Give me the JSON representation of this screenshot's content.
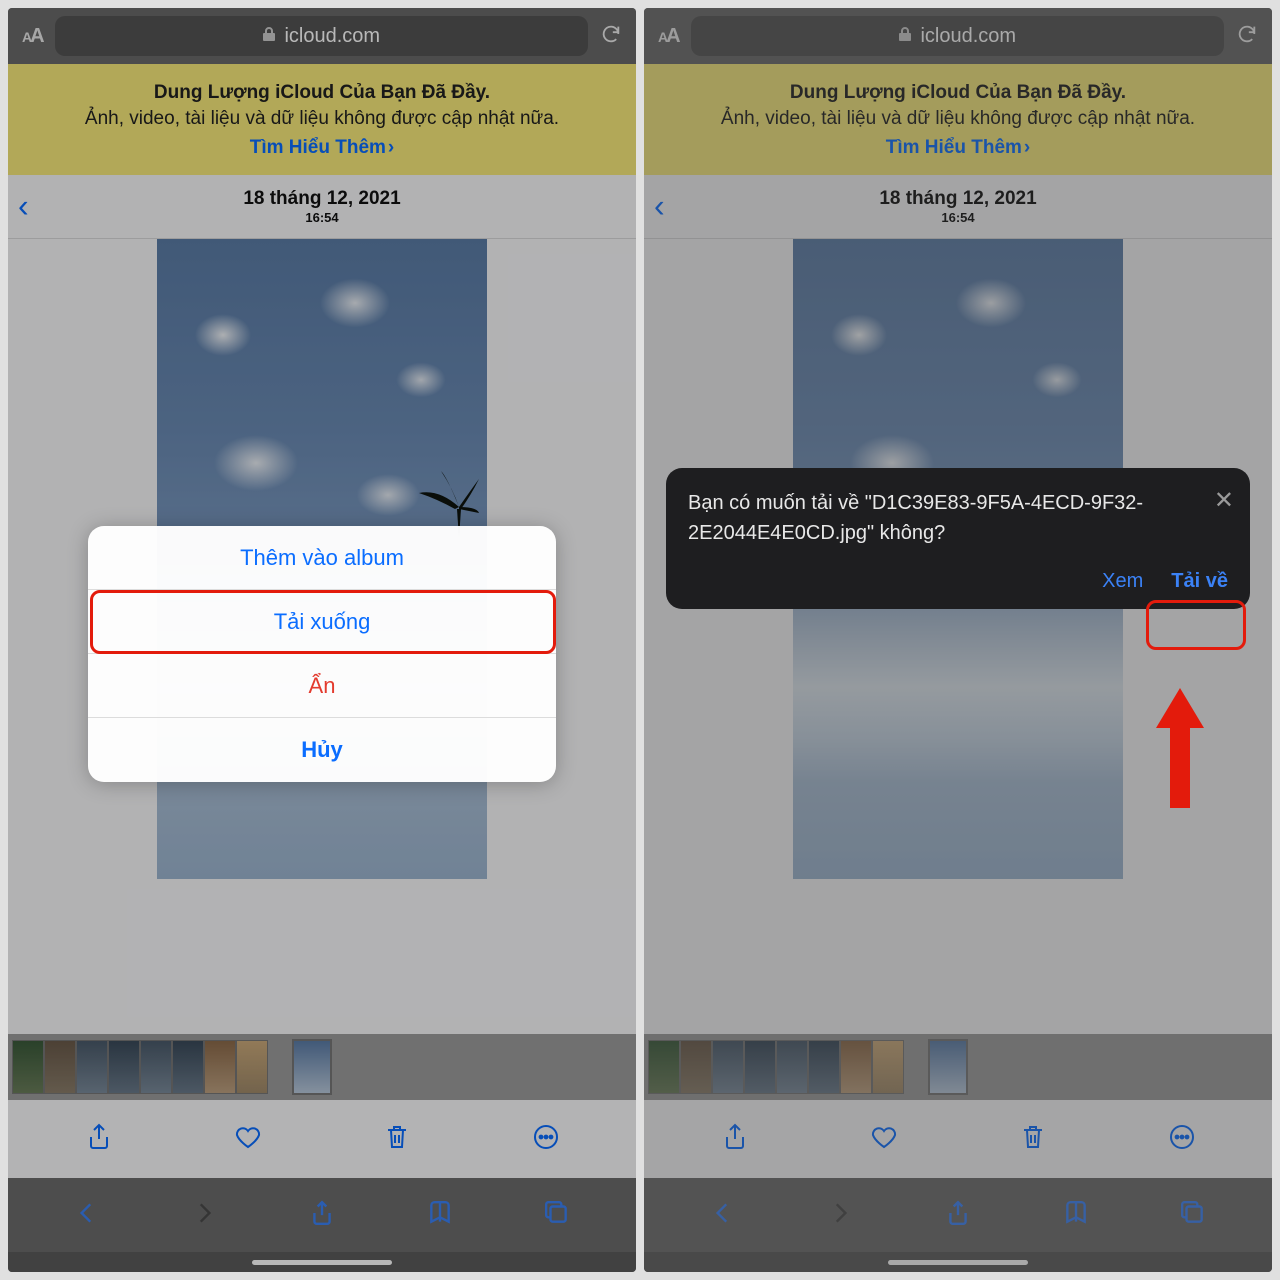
{
  "browser": {
    "domain": "icloud.com"
  },
  "banner": {
    "title": "Dung Lượng iCloud Của Bạn Đã Đầy.",
    "subtitle": "Ảnh, video, tài liệu và dữ liệu không được cập nhật nữa.",
    "link": "Tìm Hiểu Thêm"
  },
  "photo": {
    "date": "18 tháng 12, 2021",
    "time": "16:54"
  },
  "actionSheet": {
    "addToAlbum": "Thêm vào album",
    "download": "Tải xuống",
    "hide": "Ẩn",
    "cancel": "Hủy"
  },
  "downloadDialog": {
    "prompt": "Bạn có muốn tải về \"D1C39E83-9F5A-4ECD-9F32-2E2044E4E0CD.jpg\" không?",
    "view": "Xem",
    "download": "Tải về"
  }
}
